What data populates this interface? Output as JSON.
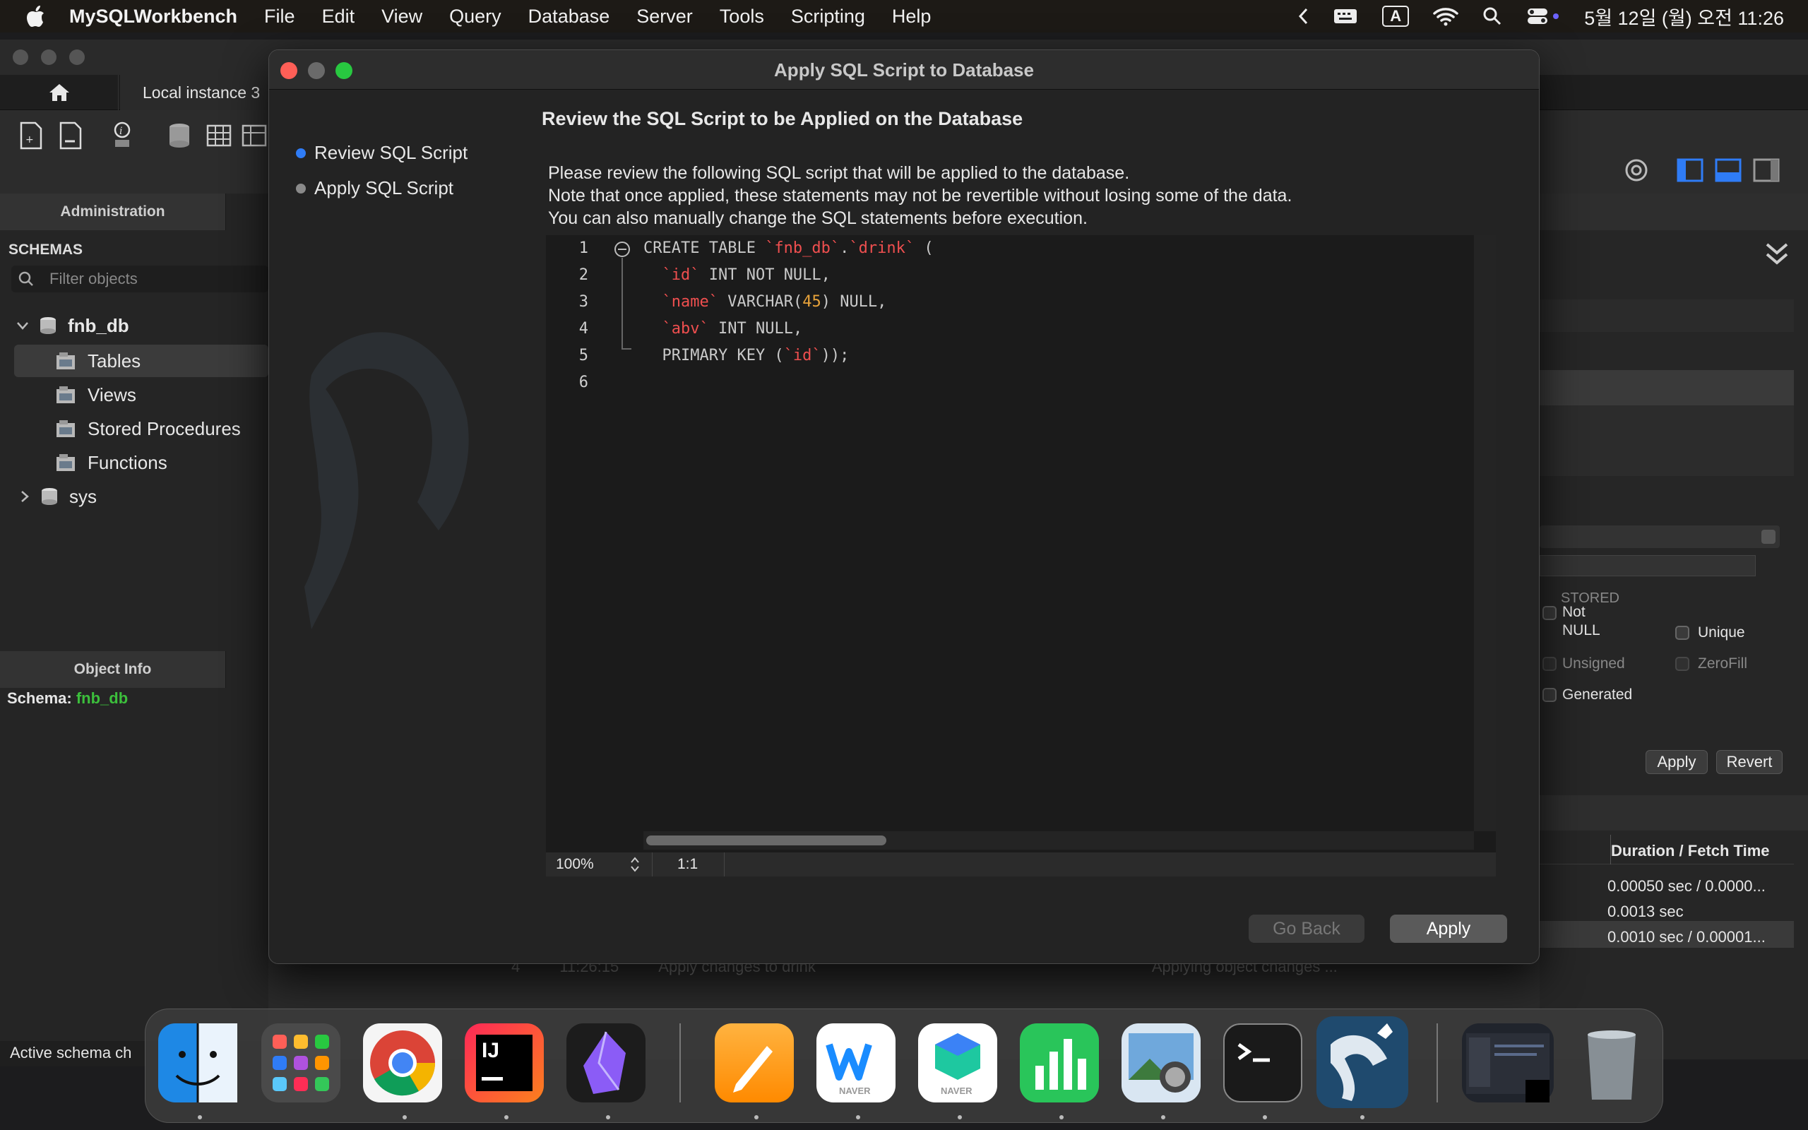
{
  "menubar": {
    "app_name": "MySQLWorkbench",
    "items": [
      "File",
      "Edit",
      "View",
      "Query",
      "Database",
      "Server",
      "Tools",
      "Scripting",
      "Help"
    ],
    "status_input_label": "A",
    "datetime": "5월 12일 (월) 오전 11:26"
  },
  "main_window": {
    "connection_tab": "Local instance 3",
    "sidebar": {
      "tab_administration": "Administration",
      "schemas_label": "SCHEMAS",
      "filter_placeholder": "Filter objects",
      "tree": {
        "db1": "fnb_db",
        "children": [
          "Tables",
          "Views",
          "Stored Procedures",
          "Functions"
        ],
        "db2": "sys"
      },
      "object_info_tab": "Object Info",
      "schema_label": "Schema:",
      "schema_value": "fnb_db",
      "status": "Active schema ch"
    },
    "right_panel": {
      "stored_label": "STORED",
      "not_null_label": "Not NULL",
      "unique_label": "Unique",
      "unsigned_label": "Unsigned",
      "zerofill_label": "ZeroFill",
      "generated_label": "Generated",
      "apply_label": "Apply",
      "revert_label": "Revert",
      "col_header": "Duration / Fetch Time",
      "rows": [
        "0.00050 sec / 0.0000...",
        "0.0013 sec",
        "0.0010 sec / 0.00001..."
      ]
    },
    "output_row": {
      "num": "4",
      "time": "11:26:15",
      "action": "Apply changes to drink",
      "message": "Applying object changes ..."
    }
  },
  "dialog": {
    "title": "Apply SQL Script to Database",
    "steps": [
      "Review SQL Script",
      "Apply SQL Script"
    ],
    "heading": "Review the SQL Script to be Applied on the Database",
    "description": [
      "Please review the following SQL script that will be applied to the database.",
      "Note that once applied, these statements may not be revertible without losing some of the data.",
      "You can also manually change the SQL statements before execution."
    ],
    "line_numbers": [
      "1",
      "2",
      "3",
      "4",
      "5",
      "6"
    ],
    "zoom": "100%",
    "cursor_pos": "1:1",
    "go_back_label": "Go Back",
    "apply_label": "Apply"
  },
  "dock": {
    "apps": [
      "finder-icon",
      "launchpad-icon",
      "chrome-icon",
      "intellij-icon",
      "obsidian-icon",
      "pages-icon",
      "naver-whale-icon",
      "naver-box-icon",
      "numbers-icon",
      "preview-icon",
      "terminal-icon",
      "mysql-workbench-icon",
      "window-thumbnail-icon",
      "trash-icon"
    ],
    "naver_label": "NAVER",
    "intellij_label": "IJ"
  },
  "colors": {
    "accent": "#2f7cf6",
    "sql_identifier": "#ef4f4f",
    "sql_number": "#e8a33a",
    "schema_green": "#3cbf3c"
  }
}
